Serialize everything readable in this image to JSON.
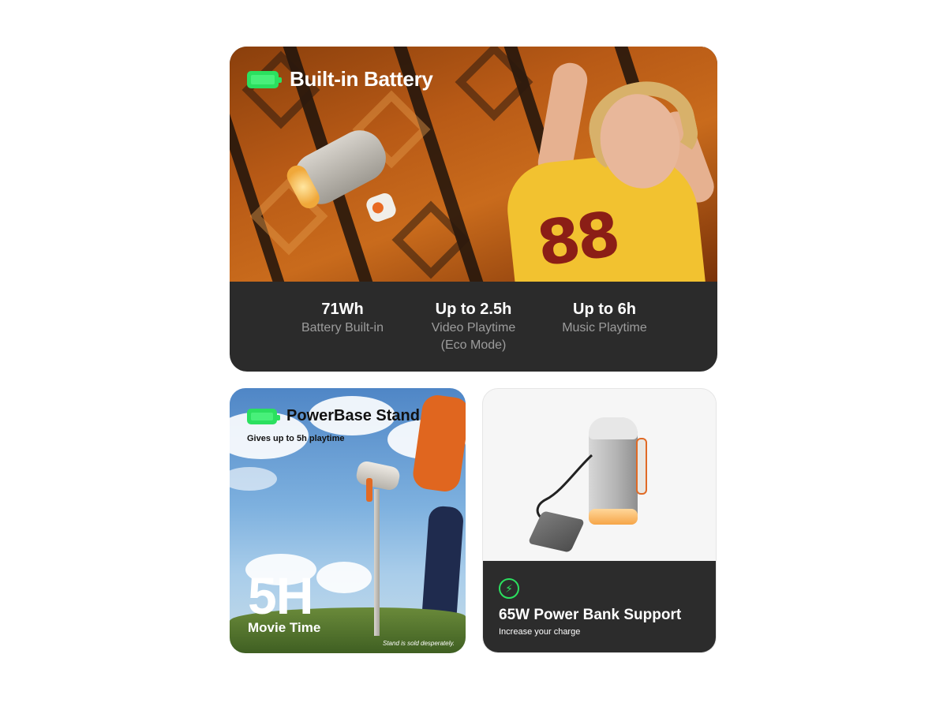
{
  "top_card": {
    "title": "Built-in Battery",
    "icon": "battery-full-icon",
    "stats": [
      {
        "value": "71Wh",
        "label": "Battery Built-in",
        "label2": ""
      },
      {
        "value": "Up to 2.5h",
        "label": "Video Playtime",
        "label2": "(Eco Mode)"
      },
      {
        "value": "Up to 6h",
        "label": "Music Playtime",
        "label2": ""
      }
    ]
  },
  "powerbase_card": {
    "title": "PowerBase Stand",
    "icon": "battery-full-icon",
    "subtitle": "Gives up to 5h playtime",
    "big_number": "5H",
    "big_label": "Movie Time",
    "note": "Stand is sold desperately."
  },
  "powerbank_card": {
    "icon": "lightning-bolt-icon",
    "title": "65W Power Bank Support",
    "subtitle": "Increase your charge"
  },
  "colors": {
    "accent_green": "#2be05f",
    "dark_panel": "#2b2b2b",
    "stat_label_gray": "#9c9c9c"
  }
}
